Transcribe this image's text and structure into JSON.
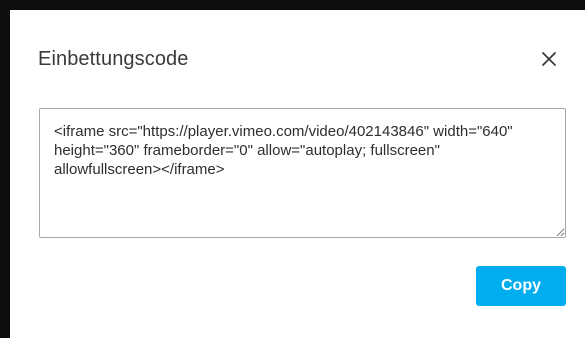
{
  "dialog": {
    "title": "Einbettungscode",
    "embed_code": "<iframe src=\"https://player.vimeo.com/video/402143846\" width=\"640\" height=\"360\" frameborder=\"0\" allow=\"autoplay; fullscreen\" allowfullscreen></iframe>",
    "copy_label": "Copy",
    "close_icon": "close-icon"
  },
  "colors": {
    "accent": "#00adef",
    "backdrop_edge": "#0e0e0e",
    "title_text": "#3a3a3a",
    "body_text": "#2e2e2e",
    "border": "#a8a8a8"
  }
}
